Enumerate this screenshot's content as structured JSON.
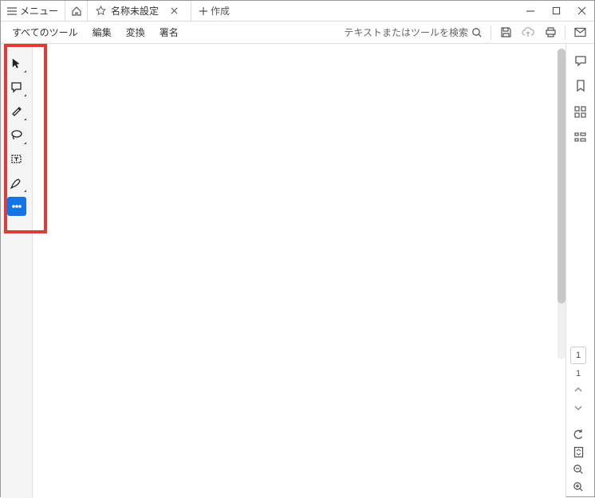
{
  "titlebar": {
    "menu_label": "メニュー",
    "tab_title": "名称未設定",
    "new_tab_label": "作成"
  },
  "toolbar": {
    "all_tools": "すべてのツール",
    "edit": "編集",
    "convert": "変換",
    "sign": "署名",
    "search_placeholder": "テキストまたはツールを検索"
  },
  "left_tools": [
    {
      "name": "select",
      "icon": "cursor-icon"
    },
    {
      "name": "comment",
      "icon": "comment-icon"
    },
    {
      "name": "highlight",
      "icon": "highlight-icon"
    },
    {
      "name": "lasso",
      "icon": "lasso-icon"
    },
    {
      "name": "textbox",
      "icon": "textbox-icon"
    },
    {
      "name": "draw",
      "icon": "draw-icon"
    },
    {
      "name": "more",
      "icon": "more-icon",
      "selected": true
    }
  ],
  "right_tools": [
    {
      "name": "chat",
      "icon": "chat-icon"
    },
    {
      "name": "bookmark",
      "icon": "bookmark-panel-icon"
    },
    {
      "name": "thumbnails",
      "icon": "thumbnails-icon"
    },
    {
      "name": "structure",
      "icon": "structure-icon"
    }
  ],
  "page": {
    "current": "1",
    "total": "1"
  }
}
